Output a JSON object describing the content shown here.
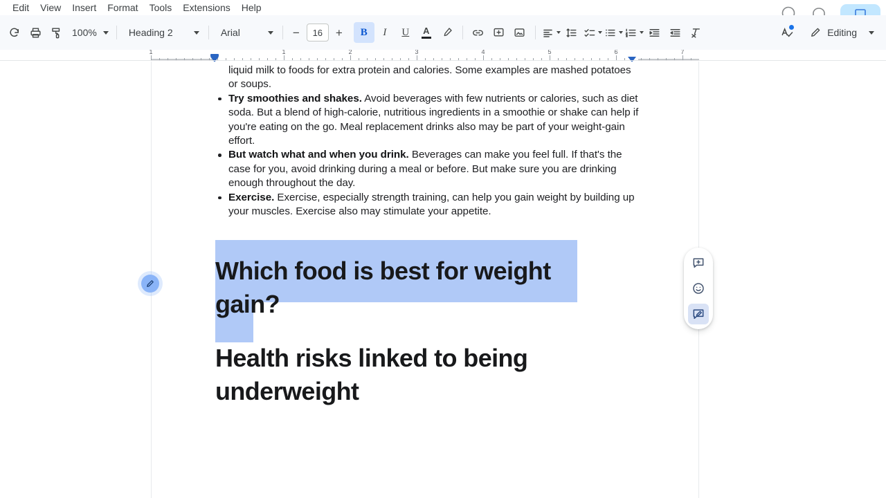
{
  "app": {
    "name": "Google Docs",
    "accent_color": "#0b57d0",
    "selection_color": "#b0c9f7",
    "toolbar_bg": "#f7f9fc",
    "active_btn_bg": "#d3e3fd"
  },
  "menubar": {
    "items": [
      {
        "label": "Edit",
        "name": "menu-edit"
      },
      {
        "label": "View",
        "name": "menu-view"
      },
      {
        "label": "Insert",
        "name": "menu-insert"
      },
      {
        "label": "Format",
        "name": "menu-format"
      },
      {
        "label": "Tools",
        "name": "menu-tools"
      },
      {
        "label": "Extensions",
        "name": "menu-extensions"
      },
      {
        "label": "Help",
        "name": "menu-help"
      }
    ]
  },
  "topright": {
    "history_icon": "clock-history-icon",
    "comment_icon": "comment-icon",
    "share_button": "share-button"
  },
  "toolbar": {
    "redo": "redo-icon",
    "print": "print-icon",
    "paint_format": "paint-format-icon",
    "zoom_value": "100%",
    "style_value": "Heading 2",
    "font_value": "Arial",
    "font_size_value": "16",
    "font_size_decrease": "−",
    "font_size_increase": "+",
    "bold_label": "B",
    "italic_label": "I",
    "underline_label": "U",
    "text_color_label": "A",
    "highlight_icon": "highlight-pen-icon",
    "link_icon": "insert-link-icon",
    "comment_icon": "add-comment-icon",
    "image_icon": "insert-image-icon",
    "align_icon": "align-left-icon",
    "line_spacing_icon": "line-spacing-icon",
    "checklist_icon": "checklist-icon",
    "bulleted_list_icon": "bulleted-list-icon",
    "numbered_list_icon": "numbered-list-icon",
    "indent_less_icon": "decrease-indent-icon",
    "indent_more_icon": "increase-indent-icon",
    "clear_format_icon": "clear-formatting-icon",
    "spellcheck_icon": "spellcheck-icon",
    "mode_icon": "pencil-icon",
    "mode_label": "Editing"
  },
  "ruler": {
    "numbers": [
      "1",
      "1",
      "2",
      "3",
      "4",
      "5",
      "6",
      "7"
    ],
    "left_indent_marker": "left-indent-marker",
    "right_indent_marker": "right-indent-marker"
  },
  "document": {
    "paragraph_continuation": "liquid milk to foods for extra protein and calories. Some examples are mashed potatoes or soups.",
    "bullets": [
      {
        "lead": "Try smoothies and shakes.",
        "rest": " Avoid beverages with few nutrients or calories, such as diet soda. But a blend of high-calorie, nutritious ingredients in a smoothie or shake can help if you're eating on the go. Meal replacement drinks also may be part of your weight-gain effort."
      },
      {
        "lead": "But watch what and when you drink.",
        "rest": " Beverages can make you feel full. If that's the case for you, avoid drinking during a meal or before. But make sure you are drinking enough throughout the day."
      },
      {
        "lead": "Exercise.",
        "rest": " Exercise, especially strength training, can help you gain weight by building up your muscles. Exercise also may stimulate your appetite."
      }
    ],
    "heading_selected": "Which food is best for weight gain?",
    "heading_next": "Health risks linked to being underweight"
  },
  "margin_chip": {
    "icon": "suggest-edit-pencil-icon"
  },
  "rail": {
    "buttons": [
      {
        "icon": "add-comment-icon",
        "name": "rail-add-comment",
        "selected": false
      },
      {
        "icon": "emoji-reaction-icon",
        "name": "rail-emoji-react",
        "selected": false
      },
      {
        "icon": "suggest-edit-icon",
        "name": "rail-suggest-edit",
        "selected": true
      }
    ]
  }
}
